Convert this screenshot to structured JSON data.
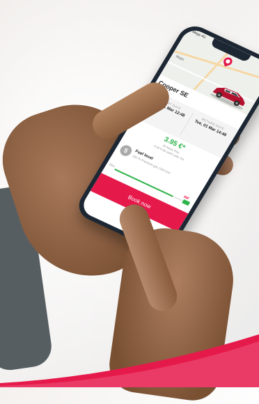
{
  "status": {
    "left": "Mega 4G"
  },
  "map": {
    "label": "Maps"
  },
  "car": {
    "name": "Cooper SE"
  },
  "booking": {
    "start_label": "START DATE",
    "start_value": "Tue, 01 Mar 12:48",
    "return_label": "RETURN DATE",
    "return_value": "Tue, 01 Mar 14:48"
  },
  "price": {
    "amount": "3.95 €*",
    "sub1": "fo hours free",
    "sub2": "0.50 € for each add. hrs"
  },
  "fuel": {
    "icon": "5",
    "title": "Fuel level",
    "sub": "160 % Premium gas (160 km)",
    "bar_label": "fillm",
    "tag": "INF",
    "level": 0.85
  },
  "actions": {
    "book_label": "Book now"
  },
  "colors": {
    "accent": "#e6194b",
    "price": "#2db34a",
    "phone": "#1c2733"
  }
}
